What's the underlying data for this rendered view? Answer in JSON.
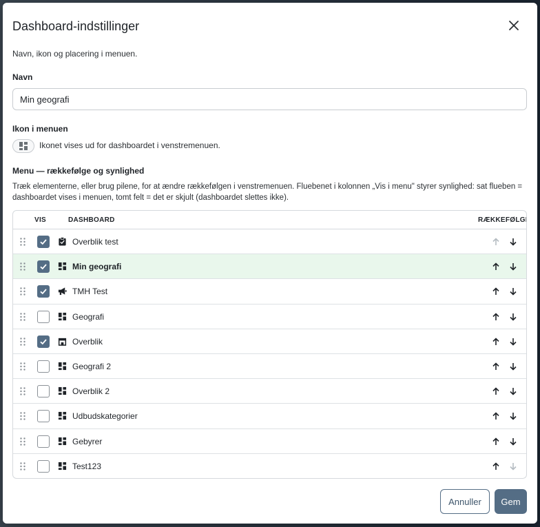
{
  "dialog": {
    "title": "Dashboard-indstillinger",
    "subtitle": "Navn, ikon og placering i menuen."
  },
  "name_field": {
    "label": "Navn",
    "value": "Min geografi"
  },
  "icon_section": {
    "label": "Ikon i menuen",
    "icon": "dashboard-grid-icon",
    "help": "Ikonet vises ud for dashboardet i venstremenuen."
  },
  "menu_section": {
    "label": "Menu — rækkefølge og synlighed",
    "description": "Træk elementerne, eller brug pilene, for at ændre rækkefølgen i venstremenuen. Fluebenet i kolonnen „Vis i menu\" styrer synlighed: sat flueben = dashboardet vises i menuen, tomt felt = det er skjult (dashboardet slettes ikke)."
  },
  "table": {
    "headers": {
      "vis": "VIS",
      "dashboard": "DASHBOARD",
      "order": "RÆKKEFØLGE"
    },
    "rows": [
      {
        "name": "Overblik test",
        "visible": true,
        "icon": "clipboard-check-icon",
        "active": false,
        "up_enabled": false,
        "down_enabled": true
      },
      {
        "name": "Min geografi",
        "visible": true,
        "icon": "dashboard-grid-icon",
        "active": true,
        "up_enabled": true,
        "down_enabled": true
      },
      {
        "name": "TMH Test",
        "visible": true,
        "icon": "megaphone-icon",
        "active": false,
        "up_enabled": true,
        "down_enabled": true
      },
      {
        "name": "Geografi",
        "visible": false,
        "icon": "dashboard-grid-icon",
        "active": false,
        "up_enabled": true,
        "down_enabled": true
      },
      {
        "name": "Overblik",
        "visible": true,
        "icon": "store-icon",
        "active": false,
        "up_enabled": true,
        "down_enabled": true
      },
      {
        "name": "Geografi 2",
        "visible": false,
        "icon": "dashboard-grid-icon",
        "active": false,
        "up_enabled": true,
        "down_enabled": true
      },
      {
        "name": "Overblik 2",
        "visible": false,
        "icon": "dashboard-grid-icon",
        "active": false,
        "up_enabled": true,
        "down_enabled": true
      },
      {
        "name": "Udbudskategorier",
        "visible": false,
        "icon": "dashboard-grid-icon",
        "active": false,
        "up_enabled": true,
        "down_enabled": true
      },
      {
        "name": "Gebyrer",
        "visible": false,
        "icon": "dashboard-grid-icon",
        "active": false,
        "up_enabled": true,
        "down_enabled": true
      },
      {
        "name": "Test123",
        "visible": false,
        "icon": "dashboard-grid-icon",
        "active": false,
        "up_enabled": true,
        "down_enabled": false
      }
    ]
  },
  "buttons": {
    "cancel": "Annuller",
    "save": "Gem"
  },
  "colors": {
    "accent": "#546d85",
    "active_row": "#e9f7ec",
    "disabled_arrow": "#b5bcc2"
  }
}
